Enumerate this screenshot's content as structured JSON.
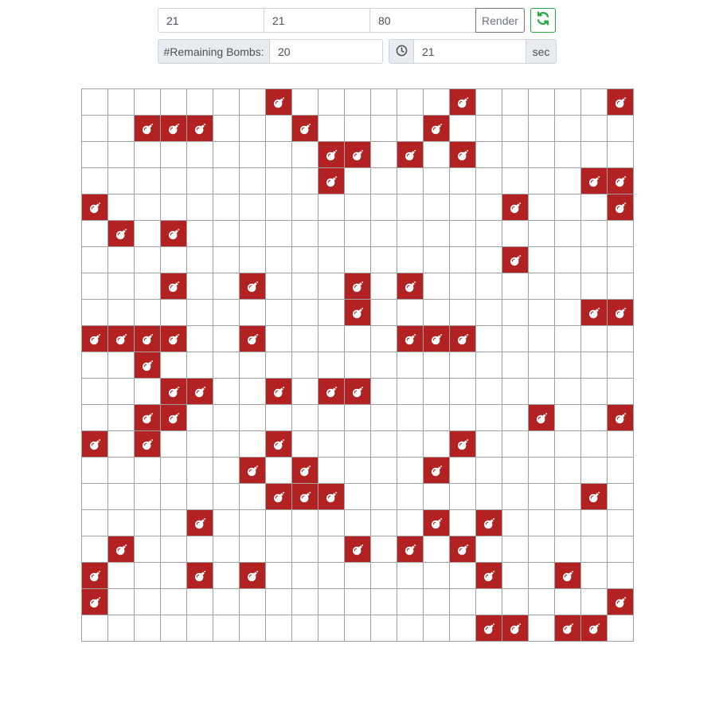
{
  "controls": {
    "rows_value": "21",
    "cols_value": "21",
    "bombs_value": "80",
    "render_label": "Render",
    "reset_icon": "refresh-icon",
    "remaining_label": "#Remaining Bombs:",
    "remaining_value": "20",
    "clock_icon": "clock-icon",
    "timer_value": "21",
    "timer_unit": "sec"
  },
  "colors": {
    "bomb_cell": "#b22222",
    "grid_line": "#a0a0a0",
    "reset_green": "#28a745"
  },
  "board": {
    "rows": 21,
    "cols": 21,
    "cell_icon": "bomb-icon",
    "bombs": [
      [
        0,
        7
      ],
      [
        0,
        14
      ],
      [
        0,
        20
      ],
      [
        1,
        2
      ],
      [
        1,
        3
      ],
      [
        1,
        4
      ],
      [
        1,
        8
      ],
      [
        1,
        13
      ],
      [
        2,
        9
      ],
      [
        2,
        10
      ],
      [
        2,
        12
      ],
      [
        2,
        14
      ],
      [
        3,
        9
      ],
      [
        3,
        19
      ],
      [
        3,
        20
      ],
      [
        4,
        0
      ],
      [
        4,
        16
      ],
      [
        4,
        20
      ],
      [
        5,
        1
      ],
      [
        5,
        3
      ],
      [
        6,
        16
      ],
      [
        7,
        3
      ],
      [
        7,
        6
      ],
      [
        7,
        10
      ],
      [
        7,
        12
      ],
      [
        8,
        10
      ],
      [
        8,
        19
      ],
      [
        8,
        20
      ],
      [
        9,
        0
      ],
      [
        9,
        1
      ],
      [
        9,
        2
      ],
      [
        9,
        3
      ],
      [
        9,
        6
      ],
      [
        9,
        12
      ],
      [
        9,
        13
      ],
      [
        9,
        14
      ],
      [
        10,
        2
      ],
      [
        11,
        3
      ],
      [
        11,
        4
      ],
      [
        11,
        7
      ],
      [
        11,
        9
      ],
      [
        11,
        10
      ],
      [
        12,
        2
      ],
      [
        12,
        3
      ],
      [
        12,
        17
      ],
      [
        12,
        20
      ],
      [
        13,
        0
      ],
      [
        13,
        2
      ],
      [
        13,
        7
      ],
      [
        13,
        14
      ],
      [
        14,
        6
      ],
      [
        14,
        8
      ],
      [
        14,
        13
      ],
      [
        15,
        7
      ],
      [
        15,
        8
      ],
      [
        15,
        9
      ],
      [
        15,
        19
      ],
      [
        16,
        4
      ],
      [
        16,
        13
      ],
      [
        16,
        15
      ],
      [
        17,
        1
      ],
      [
        17,
        10
      ],
      [
        17,
        12
      ],
      [
        17,
        14
      ],
      [
        18,
        0
      ],
      [
        18,
        4
      ],
      [
        18,
        6
      ],
      [
        18,
        15
      ],
      [
        18,
        18
      ],
      [
        19,
        0
      ],
      [
        19,
        20
      ],
      [
        20,
        15
      ],
      [
        20,
        16
      ],
      [
        20,
        18
      ],
      [
        20,
        19
      ]
    ]
  }
}
